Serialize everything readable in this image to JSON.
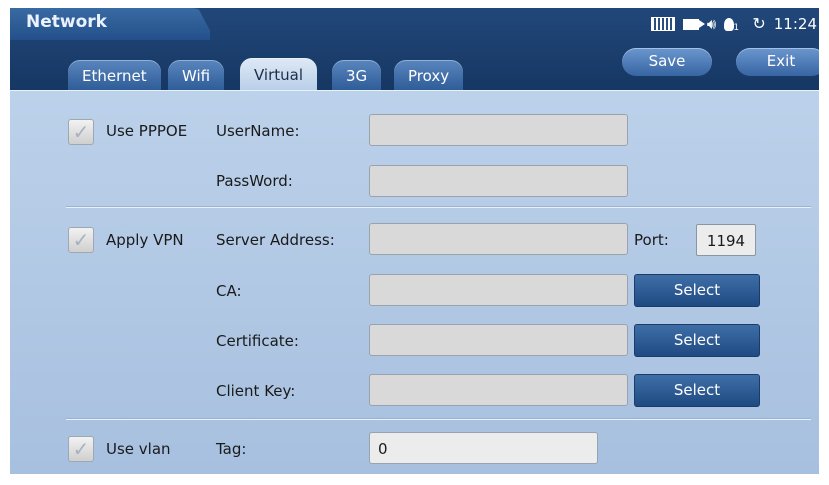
{
  "header": {
    "title": "Network",
    "time": "11:24",
    "bulb_count": "1",
    "status_icons": [
      "keyboard-icon",
      "camera-icon",
      "speaker-icon",
      "bulb-icon",
      "sync-icon"
    ],
    "tabs": [
      {
        "label": "Ethernet",
        "active": false
      },
      {
        "label": "Wifi",
        "active": false
      },
      {
        "label": "Virtual",
        "active": true
      },
      {
        "label": "3G",
        "active": false
      },
      {
        "label": "Proxy",
        "active": false
      }
    ],
    "save_label": "Save",
    "exit_label": "Exit"
  },
  "pppoe": {
    "checkbox_label": "Use PPPOE",
    "username_label": "UserName:",
    "username_value": "",
    "password_label": "PassWord:",
    "password_value": ""
  },
  "vpn": {
    "checkbox_label": "Apply VPN",
    "server_label": "Server Address:",
    "server_value": "",
    "port_label": "Port:",
    "port_value": "1194",
    "ca_label": "CA:",
    "ca_value": "",
    "certificate_label": "Certificate:",
    "certificate_value": "",
    "client_key_label": "Client Key:",
    "client_key_value": "",
    "select_label": "Select"
  },
  "vlan": {
    "checkbox_label": "Use vlan",
    "tag_label": "Tag:",
    "tag_value": "0"
  },
  "colors": {
    "header_bg": "#1d3f6c",
    "panel_bg": "#bcd1ea",
    "button_bg": "#2f5d98"
  }
}
